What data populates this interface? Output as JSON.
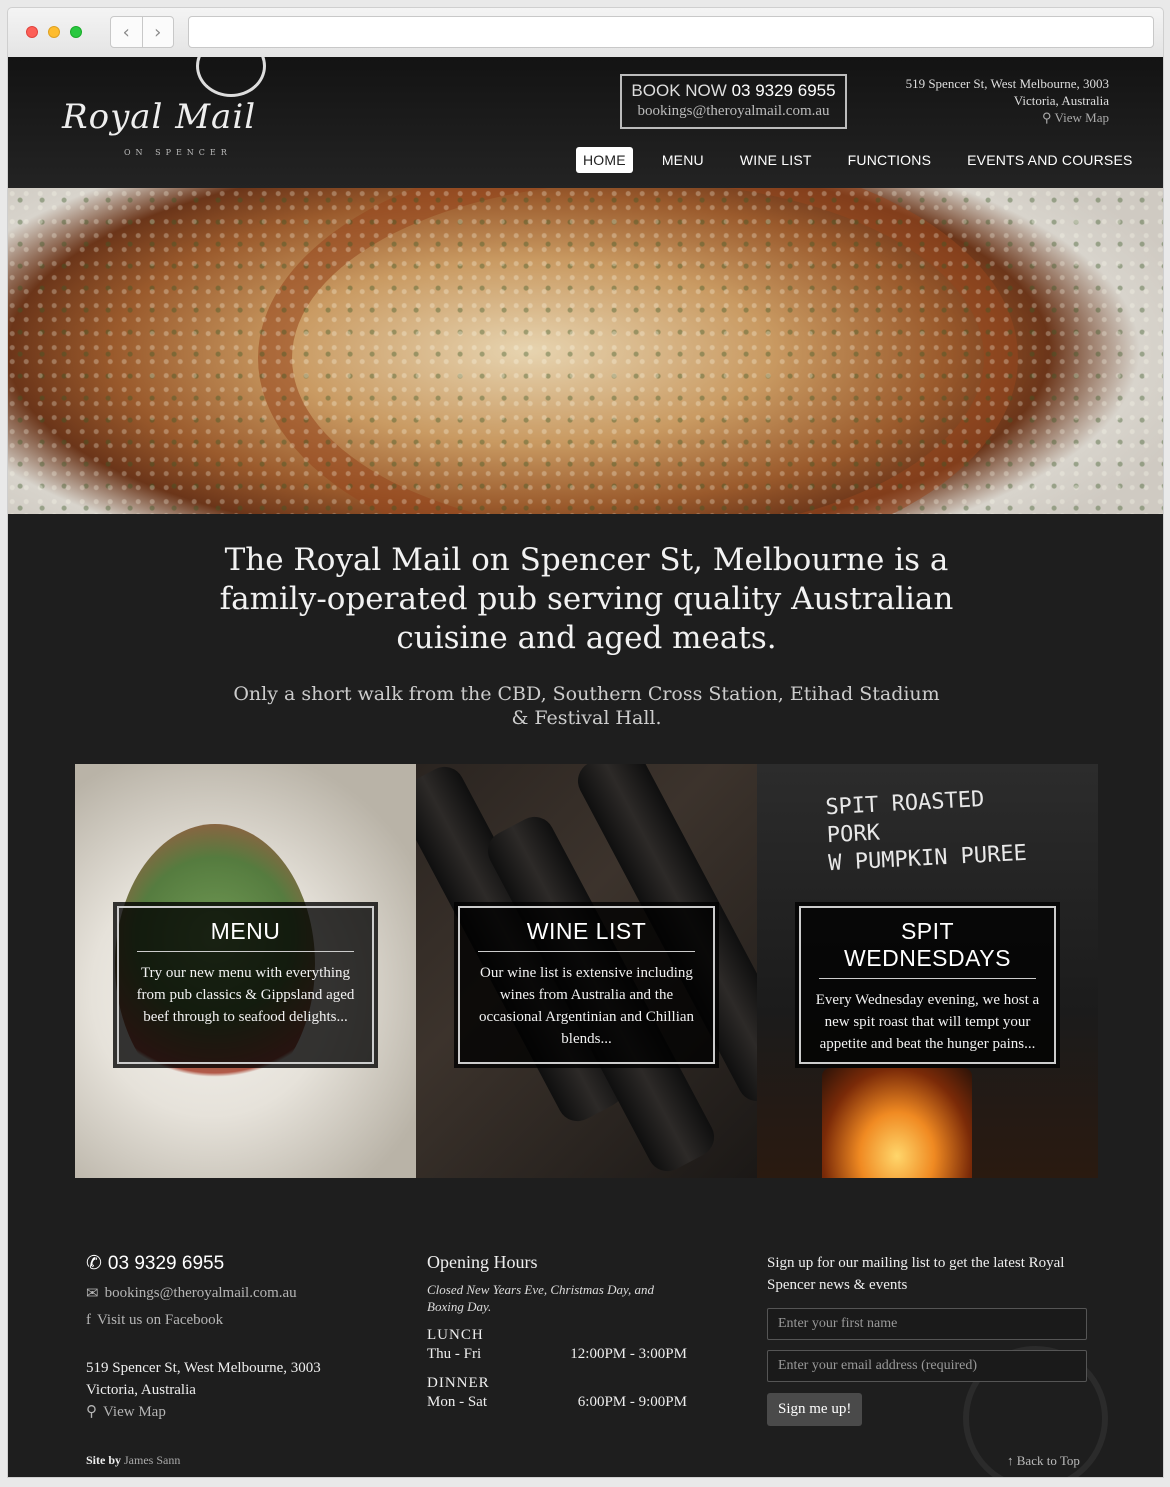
{
  "header": {
    "logo_text": "Royal Mail",
    "logo_sub": "ON SPENCER",
    "book_label": "BOOK NOW",
    "book_phone": "03 9329 6955",
    "book_email": "bookings@theroyalmail.com.au",
    "address_line1": "519 Spencer St, West Melbourne, 3003",
    "address_line2": "Victoria, Australia",
    "view_map": "View Map"
  },
  "nav": [
    "HOME",
    "MENU",
    "WINE LIST",
    "FUNCTIONS",
    "EVENTS AND COURSES"
  ],
  "intro": {
    "headline": "The Royal Mail on Spencer St, Melbourne is a family-operated pub serving quality Australian cuisine and aged meats.",
    "subline": "Only a short walk from the CBD, Southern Cross Station, Etihad Stadium & Festival Hall."
  },
  "tiles": [
    {
      "title": "MENU",
      "text": "Try our new menu with everything from pub classics & Gippsland aged beef through to seafood delights..."
    },
    {
      "title": "WINE LIST",
      "text": "Our wine list is extensive including wines from Australia and the occasional Argentinian and Chillian blends..."
    },
    {
      "title": "SPIT WEDNESDAYS",
      "text": "Every Wednesday evening, we host a new spit roast that will tempt your appetite and beat the hunger pains..."
    }
  ],
  "board_text": "SPIT ROASTED PORK\nW PUMPKIN PUREE",
  "footer": {
    "phone": "03 9329 6955",
    "email": "bookings@theroyalmail.com.au",
    "facebook": "Visit us on Facebook",
    "address_line1": "519 Spencer St, West Melbourne, 3003",
    "address_line2": "Victoria, Australia",
    "view_map": "View Map",
    "credit_label": "Site by",
    "credit_name": "James Sann",
    "hours_title": "Opening Hours",
    "closed_note": "Closed New Years Eve, Christmas Day, and Boxing Day.",
    "lunch_label": "LUNCH",
    "lunch_days": "Thu - Fri",
    "lunch_time": "12:00PM - 3:00PM",
    "dinner_label": "DINNER",
    "dinner_days": "Mon - Sat",
    "dinner_time": "6:00PM - 9:00PM",
    "mailing_title": "Sign up for our mailing list to get the latest Royal Spencer news & events",
    "first_name_placeholder": "Enter your first name",
    "email_placeholder": "Enter your email address (required)",
    "signup_button": "Sign me up!",
    "back_to_top": "Back to Top"
  }
}
